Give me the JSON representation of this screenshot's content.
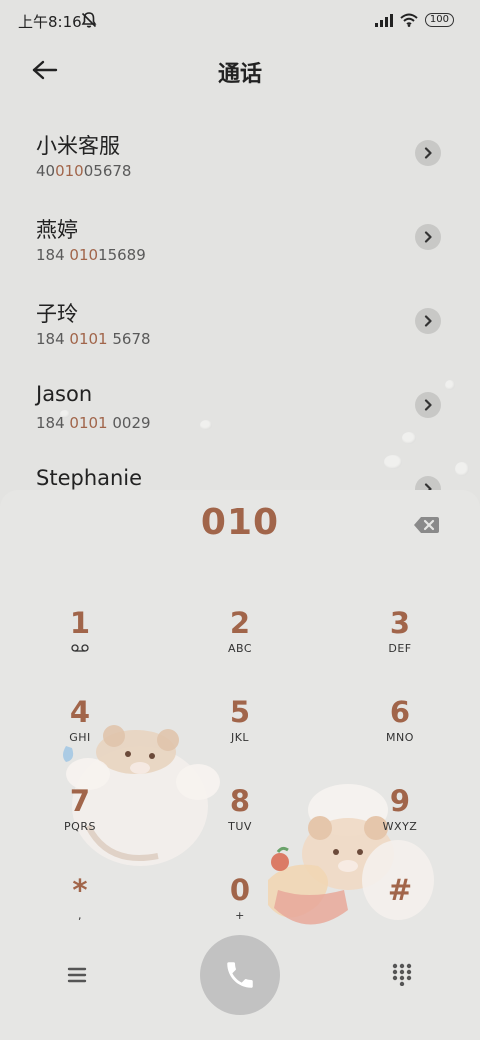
{
  "status_bar": {
    "time": "上午8:16",
    "battery": "100"
  },
  "header": {
    "title": "通话"
  },
  "contacts": [
    {
      "name": "小米客服",
      "num_pre": "40",
      "num_hl": "010",
      "num_post": "05678"
    },
    {
      "name": "燕婷",
      "num_pre": "184 ",
      "num_hl": "010",
      "num_post": "15689"
    },
    {
      "name": "子玲",
      "num_pre": "184 ",
      "num_hl": "0101",
      "num_post": " 5678"
    },
    {
      "name": "Jason",
      "num_pre": "184 ",
      "num_hl": "0101",
      "num_post": " 0029"
    },
    {
      "name": "Stephanie",
      "num_pre": "",
      "num_hl": "",
      "num_post": ""
    }
  ],
  "dialer": {
    "input": "010",
    "keys": [
      {
        "digit": "1",
        "letters": ""
      },
      {
        "digit": "2",
        "letters": "ABC"
      },
      {
        "digit": "3",
        "letters": "DEF"
      },
      {
        "digit": "4",
        "letters": "GHI"
      },
      {
        "digit": "5",
        "letters": "JKL"
      },
      {
        "digit": "6",
        "letters": "MNO"
      },
      {
        "digit": "7",
        "letters": "PQRS"
      },
      {
        "digit": "8",
        "letters": "TUV"
      },
      {
        "digit": "9",
        "letters": "WXYZ"
      },
      {
        "digit": "*",
        "letters": ","
      },
      {
        "digit": "0",
        "letters": "+"
      },
      {
        "digit": "#",
        "letters": ""
      }
    ]
  },
  "icons": {
    "back": "arrow-left-icon",
    "mute": "notifications-off-icon",
    "signal": "signal-icon",
    "wifi": "wifi-icon",
    "battery": "battery-icon",
    "voicemail": "voicemail-icon",
    "backspace": "backspace-icon",
    "menu": "menu-icon",
    "call": "phone-icon",
    "keypad": "dialpad-icon"
  },
  "colors": {
    "accent": "#a1654a",
    "background": "#e3e3e1",
    "call_button": "#c2c2c2"
  }
}
